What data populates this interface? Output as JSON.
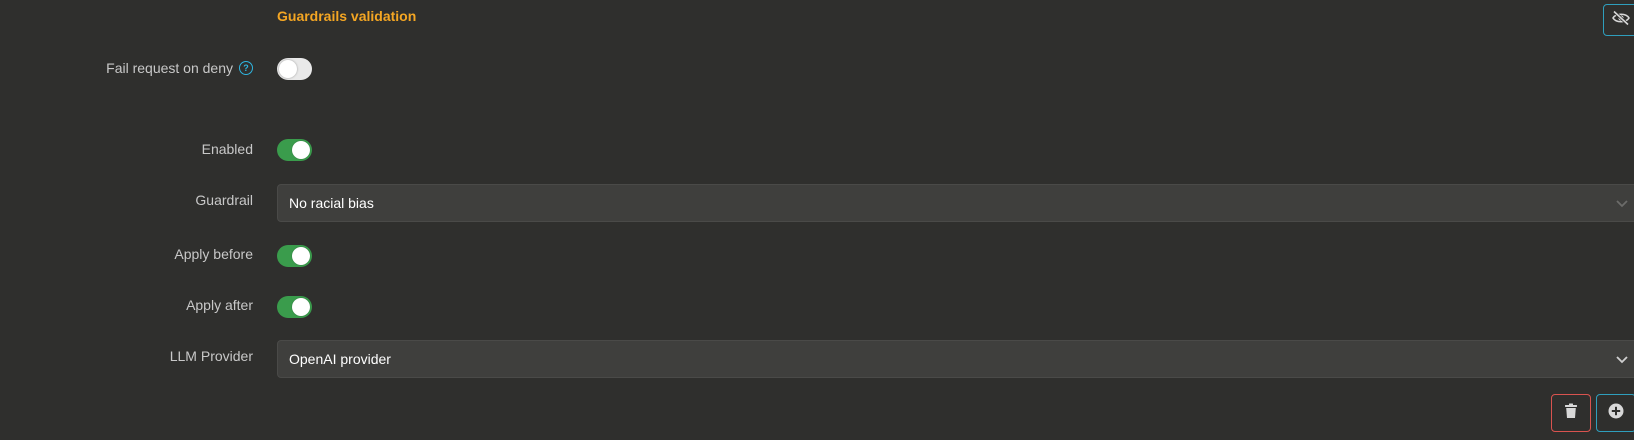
{
  "section": {
    "title": "Guardrails validation"
  },
  "fields": {
    "fail_request": {
      "label": "Fail request on deny",
      "help": "?",
      "value": false
    },
    "enabled": {
      "label": "Enabled",
      "value": true
    },
    "guardrail": {
      "label": "Guardrail",
      "value": "No racial bias"
    },
    "apply_before": {
      "label": "Apply before",
      "value": true
    },
    "apply_after": {
      "label": "Apply after",
      "value": true
    },
    "llm_provider": {
      "label": "LLM Provider",
      "value": "OpenAI provider"
    }
  },
  "icons": {
    "visibility": "eye-slash-icon",
    "delete": "trash-icon",
    "add": "plus-circle-icon",
    "chevron": "chevron-down-icon",
    "help": "question-circle-icon"
  },
  "colors": {
    "background": "#2f2f2d",
    "title_accent": "#f4a623",
    "toggle_on": "#3a9c4c",
    "info_blue": "#2fb5e0",
    "delete_red": "#d9534f"
  }
}
